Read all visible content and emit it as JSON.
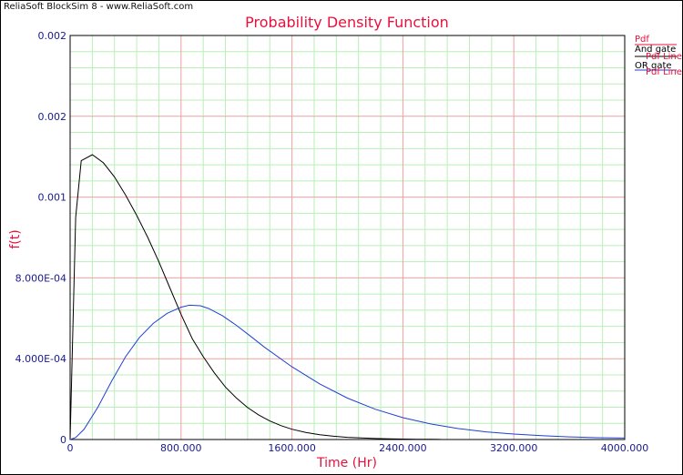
{
  "watermark": "ReliaSoft BlockSim 8 - www.ReliaSoft.com",
  "legend": {
    "heading": "Pdf",
    "entries": [
      {
        "name": "And gate",
        "line_label": "Pdf Line",
        "color": "#000000"
      },
      {
        "name": "OR gate",
        "line_label": "Pdf Line",
        "color": "#1f3fd6"
      }
    ]
  },
  "colors": {
    "title": "#e8103c",
    "tick_labels": "#1a1a8c",
    "grid_major": "#f2a0a0",
    "grid_minor": "#b8efb8",
    "and_gate": "#000000",
    "or_gate": "#1f3fd6"
  },
  "chart_data": {
    "type": "line",
    "title": "Probability Density Function",
    "xlabel": "Time (Hr)",
    "ylabel": "f(t)",
    "xlim": [
      0,
      4000
    ],
    "ylim": [
      0,
      0.002
    ],
    "x_ticks": [
      0,
      800,
      1600,
      2400,
      3200,
      4000
    ],
    "x_tick_labels": [
      "0",
      "800.000",
      "1600.000",
      "2400.000",
      "3200.000",
      "4000.000"
    ],
    "y_ticks": [
      0,
      0.0004,
      0.0008,
      0.0012,
      0.0016,
      0.002
    ],
    "y_tick_labels": [
      "0",
      "4.000E-04",
      "8.000E-04",
      "0.001",
      "0.002",
      "0.002"
    ],
    "grid": true,
    "legend_position": "top-right outside",
    "series": [
      {
        "name": "And gate",
        "x": [
          0,
          40,
          80,
          160,
          240,
          320,
          400,
          480,
          560,
          640,
          720,
          800,
          880,
          960,
          1040,
          1120,
          1200,
          1280,
          1360,
          1440,
          1520,
          1600,
          1700,
          1800,
          1900,
          2000,
          2100,
          2200,
          2300,
          2400,
          2500,
          2600,
          2670
        ],
        "y": [
          0,
          0.0011,
          0.00138,
          0.00141,
          0.00137,
          0.0013,
          0.00121,
          0.00111,
          0.001,
          0.00088,
          0.00075,
          0.00062,
          0.0005,
          0.00041,
          0.00033,
          0.00026,
          0.000205,
          0.000158,
          0.000121,
          9.2e-05,
          6.9e-05,
          5.1e-05,
          3.5e-05,
          2.4e-05,
          1.6e-05,
          1.1e-05,
          7.5e-06,
          5e-06,
          3.3e-06,
          2.2e-06,
          1.4e-06,
          9e-07,
          6e-07
        ]
      },
      {
        "name": "OR gate",
        "x": [
          0,
          40,
          100,
          200,
          300,
          400,
          500,
          600,
          700,
          800,
          860,
          940,
          1000,
          1100,
          1200,
          1300,
          1400,
          1600,
          1800,
          2000,
          2200,
          2400,
          2600,
          2800,
          3000,
          3200,
          3400,
          3600,
          3800,
          4000
        ],
        "y": [
          0,
          1e-05,
          5e-05,
          0.00016,
          0.00029,
          0.00041,
          0.000505,
          0.000575,
          0.000625,
          0.000655,
          0.000665,
          0.000662,
          0.000648,
          0.000612,
          0.000565,
          0.000512,
          0.000458,
          0.00036,
          0.000275,
          0.000205,
          0.00015,
          0.000108,
          7.7e-05,
          5.4e-05,
          3.8e-05,
          2.7e-05,
          1.9e-05,
          1.3e-05,
          9e-06,
          7e-06
        ]
      }
    ]
  }
}
